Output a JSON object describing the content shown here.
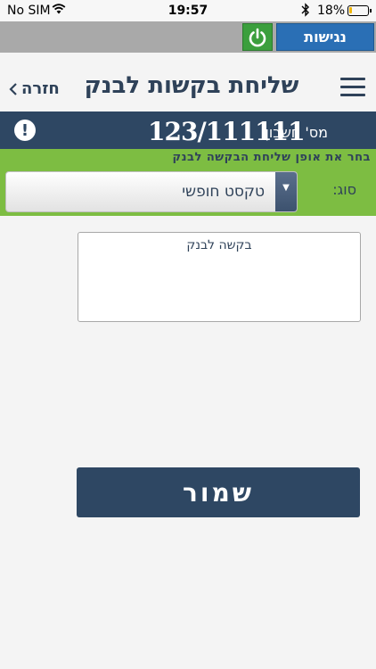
{
  "status_bar": {
    "carrier": "No SIM",
    "time": "19:57",
    "battery_percent": "18%",
    "battery_level": 0.18
  },
  "top_bar": {
    "access_label": "נגישות",
    "power_icon": "power-icon"
  },
  "header": {
    "title": "שליחת בקשות לבנק",
    "back_label": "חזרה",
    "back_icon": "chevron-left-icon",
    "menu_icon": "hamburger-menu-icon"
  },
  "account": {
    "label": "מס' חשבון:",
    "number": "123/111111",
    "alert_icon": "exclamation-icon",
    "alert_glyph": "!"
  },
  "request_type": {
    "instruction": "בחר את אופן שליחת הבקשה לבנק",
    "label": "סוג:",
    "selected": "טקסט חופשי",
    "arrow_glyph": "▼"
  },
  "request_input": {
    "placeholder": "בקשה לבנק",
    "value": ""
  },
  "actions": {
    "save_label": "שמור"
  },
  "colors": {
    "navy": "#2e4763",
    "green": "#7dbd42",
    "blue_button": "#2a6fb5",
    "power_green": "#3b9f3d"
  }
}
